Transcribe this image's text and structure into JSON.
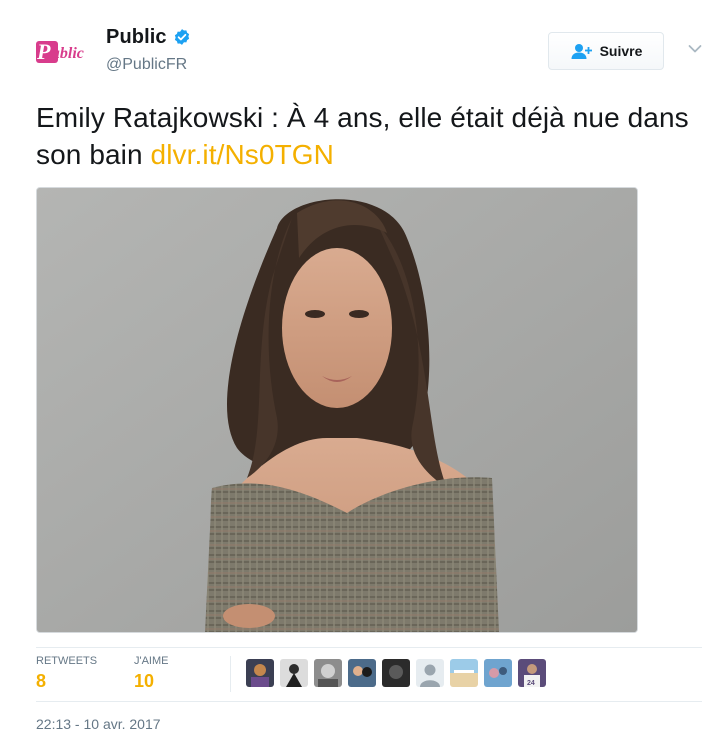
{
  "author": {
    "logo_text": "Public",
    "name": "Public",
    "handle": "@PublicFR",
    "verified_icon": "verified-badge-icon"
  },
  "follow_button": {
    "label": "Suivre",
    "icon": "add-user-icon"
  },
  "menu": {
    "icon": "chevron-down-icon"
  },
  "tweet": {
    "text": "Emily Ratajkowski : À 4 ans, elle était déjà nue dans son bain ",
    "link": "dlvr.it/Ns0TGN"
  },
  "stats": {
    "retweets_label": "RETWEETS",
    "retweets_value": "8",
    "likes_label": "J'AIME",
    "likes_value": "10"
  },
  "timestamp": "22:13 - 10 avr. 2017",
  "colors": {
    "accent": "#f4b000",
    "verified": "#1da1f2",
    "logo": "#d83c8c",
    "text_secondary": "#657786"
  }
}
